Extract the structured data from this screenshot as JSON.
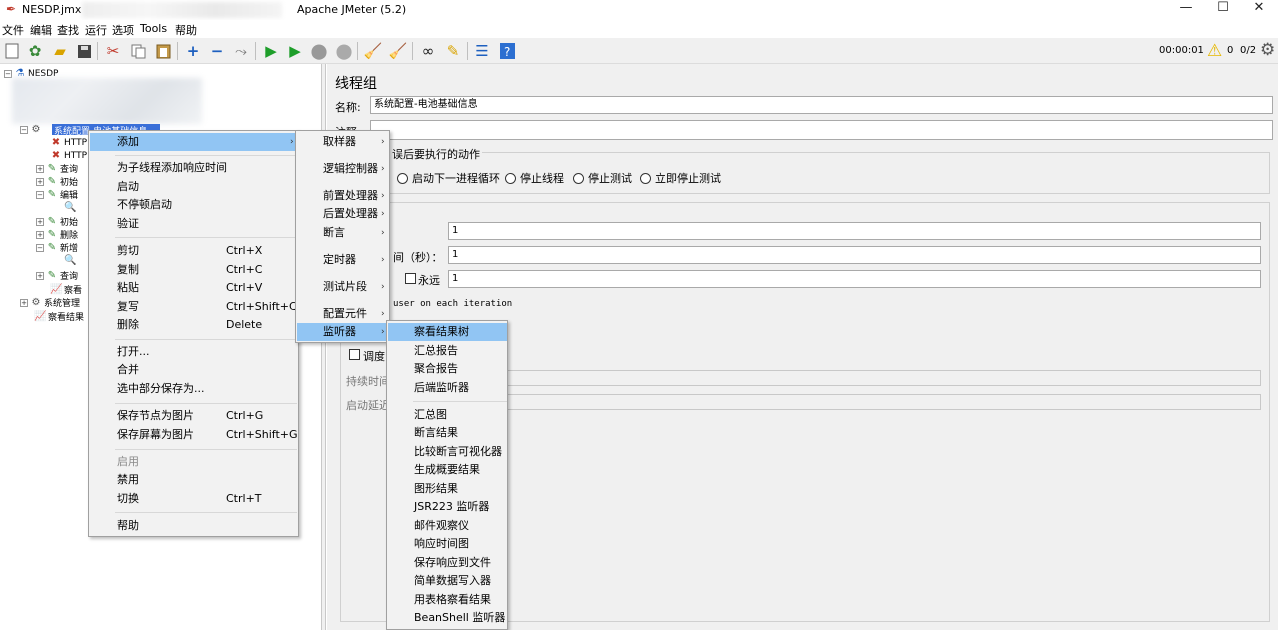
{
  "titlebar": {
    "file_name": "NESDP.jmx",
    "window_title": "Apache JMeter (5.2)",
    "minimize_glyph": "—",
    "maximize_glyph": "☐",
    "close_glyph": "✕"
  },
  "menubar": [
    "文件",
    "编辑",
    "查找",
    "运行",
    "选项",
    "Tools",
    "帮助"
  ],
  "toolbar": {
    "timer": "00:00:01",
    "error_count": "0",
    "thread_count": "0/2"
  },
  "tree": {
    "root": "NESDP",
    "selected": "系统配置-电池基础信息",
    "rows": [
      "HTTP",
      "HTTP",
      "查询",
      "初始",
      "编辑",
      "",
      "初始",
      "删除",
      "新增",
      "",
      "查询",
      "察看"
    ],
    "system_mgmt": "系统管理",
    "view_results": "察看结果"
  },
  "panel": {
    "title": "线程组",
    "name_label": "名称:",
    "name_value": "系统配置-电池基础信息",
    "comment_label": "注释:",
    "error_action_label": "取样器错误后要执行的动作",
    "error_action_visible": "误后要执行的动作",
    "radio_next_loop": "启动下一进程循环",
    "radio_stop_thread": "停止线程",
    "radio_stop_test": "停止测试",
    "radio_stop_now": "立即停止测试",
    "threads_value": "1",
    "rampup_label": "间（秒）：",
    "rampup_value": "1",
    "forever_label": "永远",
    "loop_value": "1",
    "same_user": "user on each iteration",
    "scheduler_label": "调度",
    "duration_label": "持续时间",
    "startup_delay_label": "启动延迟"
  },
  "context_menu": {
    "add": "添加",
    "add_response_time": "为子线程添加响应时间",
    "start": "启动",
    "start_no_pause": "不停顿启动",
    "validate": "验证",
    "cut": "剪切",
    "cut_key": "Ctrl+X",
    "copy": "复制",
    "copy_key": "Ctrl+C",
    "paste": "粘贴",
    "paste_key": "Ctrl+V",
    "duplicate": "复写",
    "duplicate_key": "Ctrl+Shift+C",
    "delete": "删除",
    "delete_key": "Delete",
    "open": "打开...",
    "merge": "合并",
    "save_selection": "选中部分保存为...",
    "save_node_image": "保存节点为图片",
    "save_node_image_key": "Ctrl+G",
    "save_screen_image": "保存屏幕为图片",
    "save_screen_image_key": "Ctrl+Shift+G",
    "enable": "启用",
    "disable": "禁用",
    "toggle": "切换",
    "toggle_key": "Ctrl+T",
    "help": "帮助"
  },
  "add_submenu": [
    "取样器",
    "逻辑控制器",
    "前置处理器",
    "后置处理器",
    "断言",
    "定时器",
    "测试片段",
    "配置元件",
    "监听器"
  ],
  "listener_submenu": [
    "察看结果树",
    "汇总报告",
    "聚合报告",
    "后端监听器",
    "汇总图",
    "断言结果",
    "比较断言可视化器",
    "生成概要结果",
    "图形结果",
    "JSR223 监听器",
    "邮件观察仪",
    "响应时间图",
    "保存响应到文件",
    "简单数据写入器",
    "用表格察看结果",
    "BeanShell 监听器"
  ],
  "colors": {
    "highlight": "#91c5f3",
    "tree_selection": "#3a6fd8",
    "menu_bg": "#f2f2f2"
  }
}
